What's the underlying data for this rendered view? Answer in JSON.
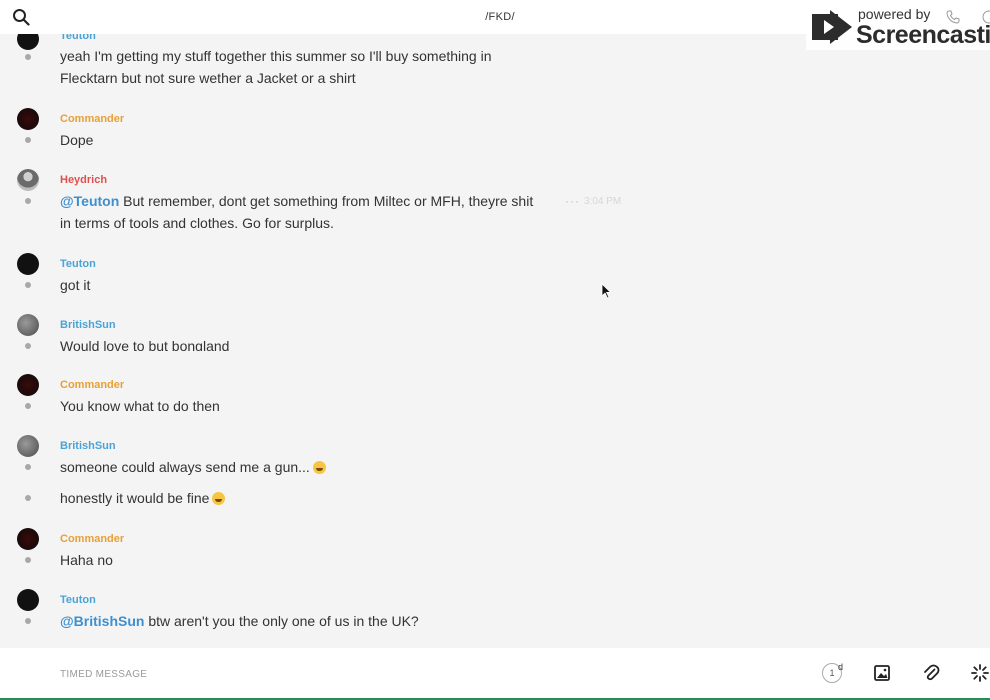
{
  "header": {
    "channel_title": "/FKD/",
    "search_icon": "search-icon",
    "call_icon": "phone-icon",
    "info_icon": "info-icon"
  },
  "watermark": {
    "top_text": "powered by",
    "brand_text": "Screencastify"
  },
  "messages": [
    {
      "author": "Teuton",
      "lines": [
        "yeah I'm getting my stuff together this summer so I'll buy something in",
        "Flecktarn but not sure wether a Jacket or a shirt"
      ]
    },
    {
      "author": "Commander",
      "lines": [
        "Dope"
      ]
    },
    {
      "author": "Heydrich",
      "mention": "@Teuton",
      "lines": [
        " But remember, dont get something from Miltec or MFH, theyre shit",
        "in terms of tools and clothes. Go for surplus."
      ],
      "time": "3:04 PM"
    },
    {
      "author": "Teuton",
      "lines": [
        "got it"
      ]
    },
    {
      "author": "BritishSun",
      "lines": [
        "Would love to but bongland"
      ]
    },
    {
      "author": "Commander",
      "lines": [
        "You know what to do then"
      ]
    },
    {
      "author": "BritishSun",
      "lines": [
        "someone could always send me a gun...",
        "honestly it would be fine"
      ]
    },
    {
      "author": "Commander",
      "lines": [
        "Haha no"
      ]
    },
    {
      "author": "Teuton",
      "mention": "@BritishSun",
      "lines": [
        " btw aren't you the only one of us in the UK?"
      ]
    }
  ],
  "composer": {
    "placeholder": "TIMED MESSAGE",
    "timer_value": "1",
    "timer_unit": "d"
  },
  "colors": {
    "teuton": "#4aa3d6",
    "commander": "#e8a036",
    "heydrich": "#e0504a",
    "mention": "#3d8fd0"
  }
}
